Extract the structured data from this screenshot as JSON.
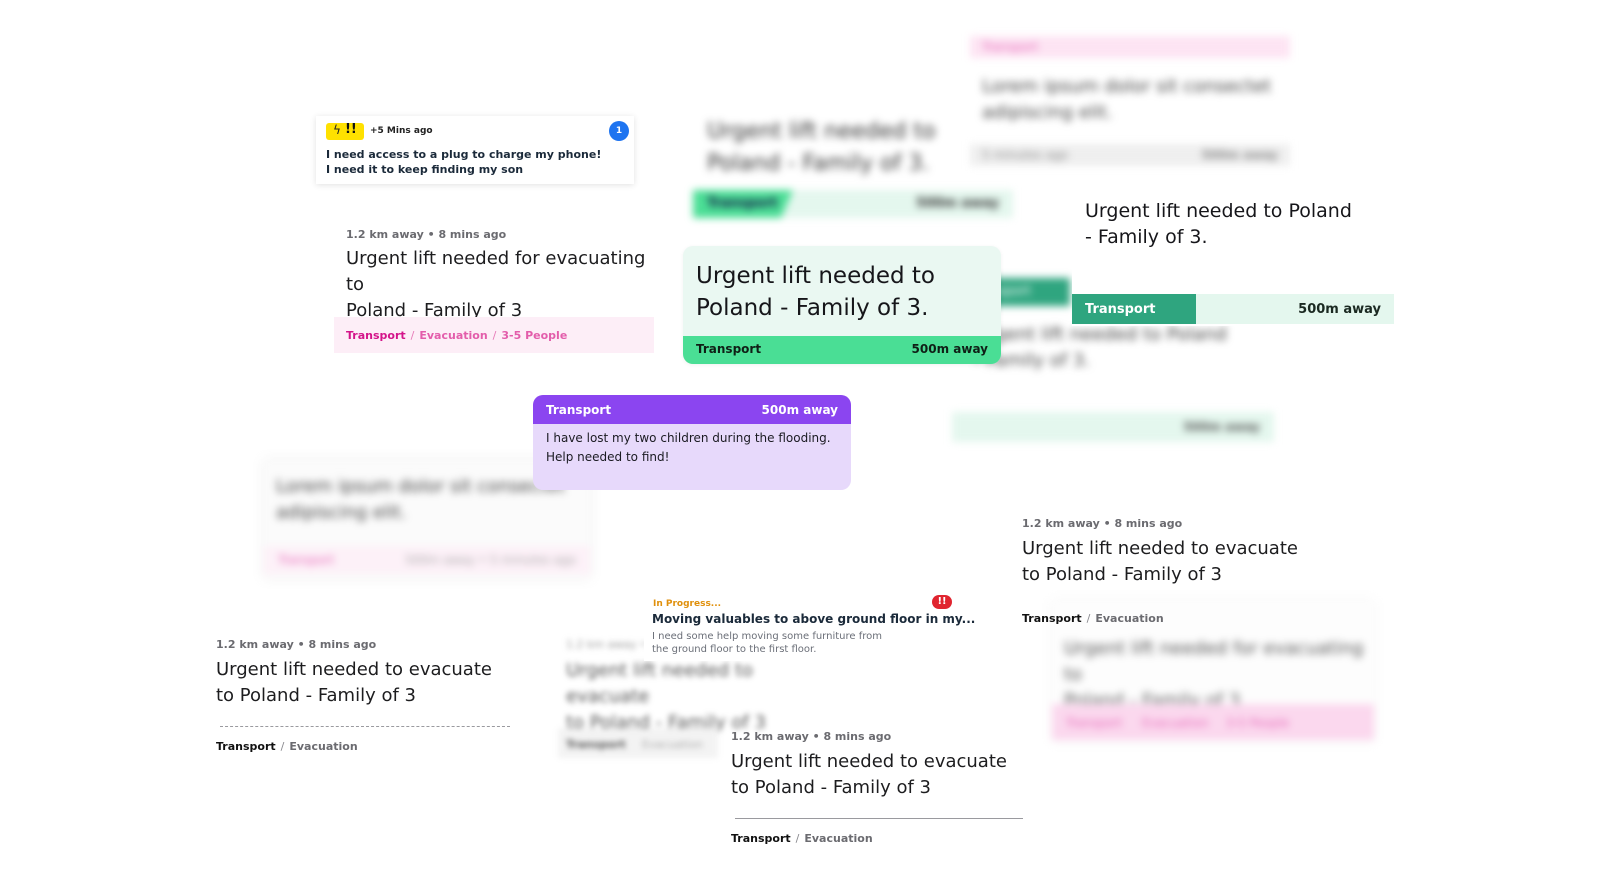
{
  "notif": {
    "time": "+5 Mins ago",
    "badge": "1",
    "line1": "I need access to a plug to charge my phone!",
    "line2": "I need it to keep finding my son"
  },
  "card_a": {
    "meta": "1.2 km away • 8 mins ago",
    "title1": "Urgent lift needed for evacuating to",
    "title2": "Poland - Family of 3",
    "tag1": "Transport",
    "sep": "/",
    "tag2": "Evacuation",
    "tag3": "3-5 People"
  },
  "card_b": {
    "title1": "Urgent lift needed to",
    "title2": "Poland - Family of 3.",
    "category": "Transport",
    "distance": "500m away"
  },
  "card_c": {
    "title1": "Urgent lift needed to Poland",
    "title2": "- Family of 3.",
    "category": "Transport",
    "distance": "500m away"
  },
  "card_d": {
    "category": "Transport",
    "distance": "500m away",
    "line1": "I have lost my two children during the flooding.",
    "line2": "Help needed to find!"
  },
  "card_e": {
    "meta": "1.2 km away • 8 mins ago",
    "title1": "Urgent lift needed to evacuate",
    "title2": "to Poland - Family of 3",
    "tag1": "Transport",
    "sep": "/",
    "tag2": "Evacuation"
  },
  "card_f": {
    "meta": "1.2 km away • 8 mins ago",
    "title1": "Urgent lift needed to evacuate",
    "title2": "to Poland - Family of 3",
    "tag1": "Transport",
    "sep": "/",
    "tag2": "Evacuation"
  },
  "card_g": {
    "status": "In Progress...",
    "alert": "!!",
    "title": "Moving valuables to above ground floor in my...",
    "line1": "I need some help moving some furniture from",
    "line2": "the ground floor to the first floor."
  },
  "card_h": {
    "meta": "1.2 km away • 8 mins ago",
    "title1": "Urgent lift needed to evacuate",
    "title2": "to Poland - Family of 3",
    "tag1": "Transport",
    "sep": "/",
    "tag2": "Evacuation"
  },
  "blurred": {
    "top_title1": "Urgent lift needed to",
    "top_title2": "Poland - Family of 3.",
    "top_tag": "Transport",
    "top_dist": "500m away",
    "lorem1": "Lorem ipsum dolor sit consectet",
    "lorem2": "adipiscing elit.",
    "right_tag": "Transport",
    "right_time": "5 minutes ago",
    "right_dist": "500m away",
    "mid_title1": "Urgent lift needed to Poland",
    "mid_title2": "- Family of 3.",
    "mid_tag": "Transport",
    "mid_dist": "500m away",
    "left_lorem1": "Lorem ipsum dolor sit consectet",
    "left_lorem2": "adipiscing elit.",
    "left_tag": "Transport",
    "left_meta": "500m away • 5 minutes ago",
    "center_meta": "1.2 km away • 8 mins ago",
    "center_title1": "Urgent lift needed to evacuate",
    "center_title2": "to Poland - Family of 3",
    "center_tag1": "Transport",
    "center_tag2": "Evacuation",
    "br_title1": "Urgent lift needed for evacuating to",
    "br_title2": "Poland - Family of 3",
    "br_tag1": "Transport",
    "br_tag2": "Evacuation",
    "br_tag3": "3-5 People"
  },
  "colors": {
    "pink": "#d4148a",
    "green": "#4ade95",
    "teal": "#2fa57f",
    "purple": "#8b45f0",
    "purple_light": "#e7d9fb",
    "blue_badge": "#1e74f0",
    "yellow": "#ffe100",
    "red_alert": "#e0242f",
    "orange_status": "#e0900c"
  }
}
